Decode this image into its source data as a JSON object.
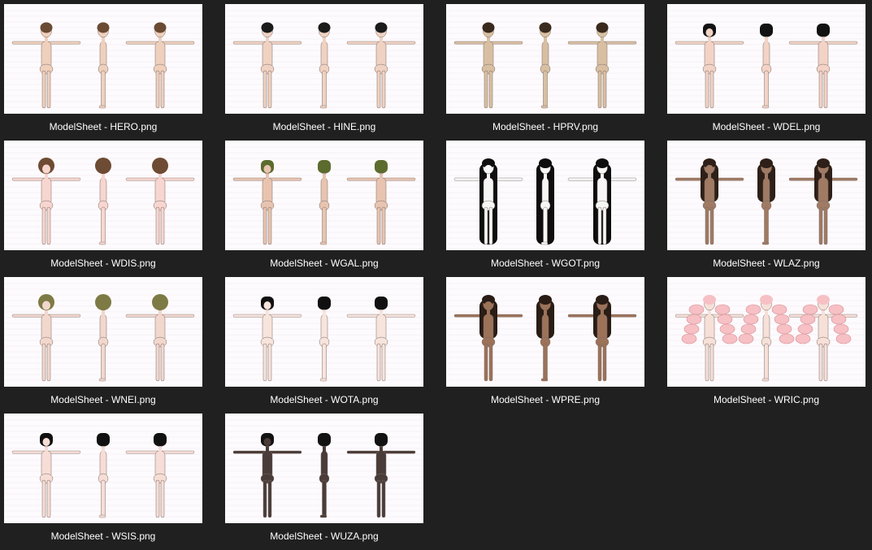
{
  "files": [
    {
      "name": "ModelSheet - HERO.png",
      "skin": "#efd0bd",
      "hair": "#6b4a33",
      "hair_style": "short"
    },
    {
      "name": "ModelSheet - HINE.png",
      "skin": "#f0d2c2",
      "hair": "#1b1b1b",
      "hair_style": "short"
    },
    {
      "name": "ModelSheet - HPRV.png",
      "skin": "#d9bfa2",
      "hair": "#3a2a1e",
      "hair_style": "short"
    },
    {
      "name": "ModelSheet - WDEL.png",
      "skin": "#f2d3c6",
      "hair": "#121212",
      "hair_style": "bob"
    },
    {
      "name": "ModelSheet - WDIS.png",
      "skin": "#f7d6cf",
      "hair": "#6e4b33",
      "hair_style": "puffy"
    },
    {
      "name": "ModelSheet - WGAL.png",
      "skin": "#e8c4b0",
      "hair": "#5c6b2e",
      "hair_style": "bob"
    },
    {
      "name": "ModelSheet - WGOT.png",
      "skin": "#f6f6f6",
      "hair": "#0e0e0e",
      "hair_style": "verylong"
    },
    {
      "name": "ModelSheet - WLAZ.png",
      "skin": "#a07a63",
      "hair": "#2e2018",
      "hair_style": "long"
    },
    {
      "name": "ModelSheet - WNEI.png",
      "skin": "#f2d7cd",
      "hair": "#7d7a45",
      "hair_style": "puffy"
    },
    {
      "name": "ModelSheet - WOTA.png",
      "skin": "#f7e4dc",
      "hair": "#101010",
      "hair_style": "bob"
    },
    {
      "name": "ModelSheet - WPRE.png",
      "skin": "#9c7259",
      "hair": "#2a1d15",
      "hair_style": "long"
    },
    {
      "name": "ModelSheet - WRIC.png",
      "skin": "#f6e0d8",
      "hair": "#f6c0c4",
      "hair_style": "drills"
    },
    {
      "name": "ModelSheet - WSIS.png",
      "skin": "#f6ddd5",
      "hair": "#111111",
      "hair_style": "bob"
    },
    {
      "name": "ModelSheet - WUZA.png",
      "skin": "#4a3c38",
      "hair": "#121212",
      "hair_style": "bob"
    }
  ],
  "colors": {
    "background": "#202020",
    "thumb_bg": "#fdfbfd",
    "label": "#ffffff"
  }
}
